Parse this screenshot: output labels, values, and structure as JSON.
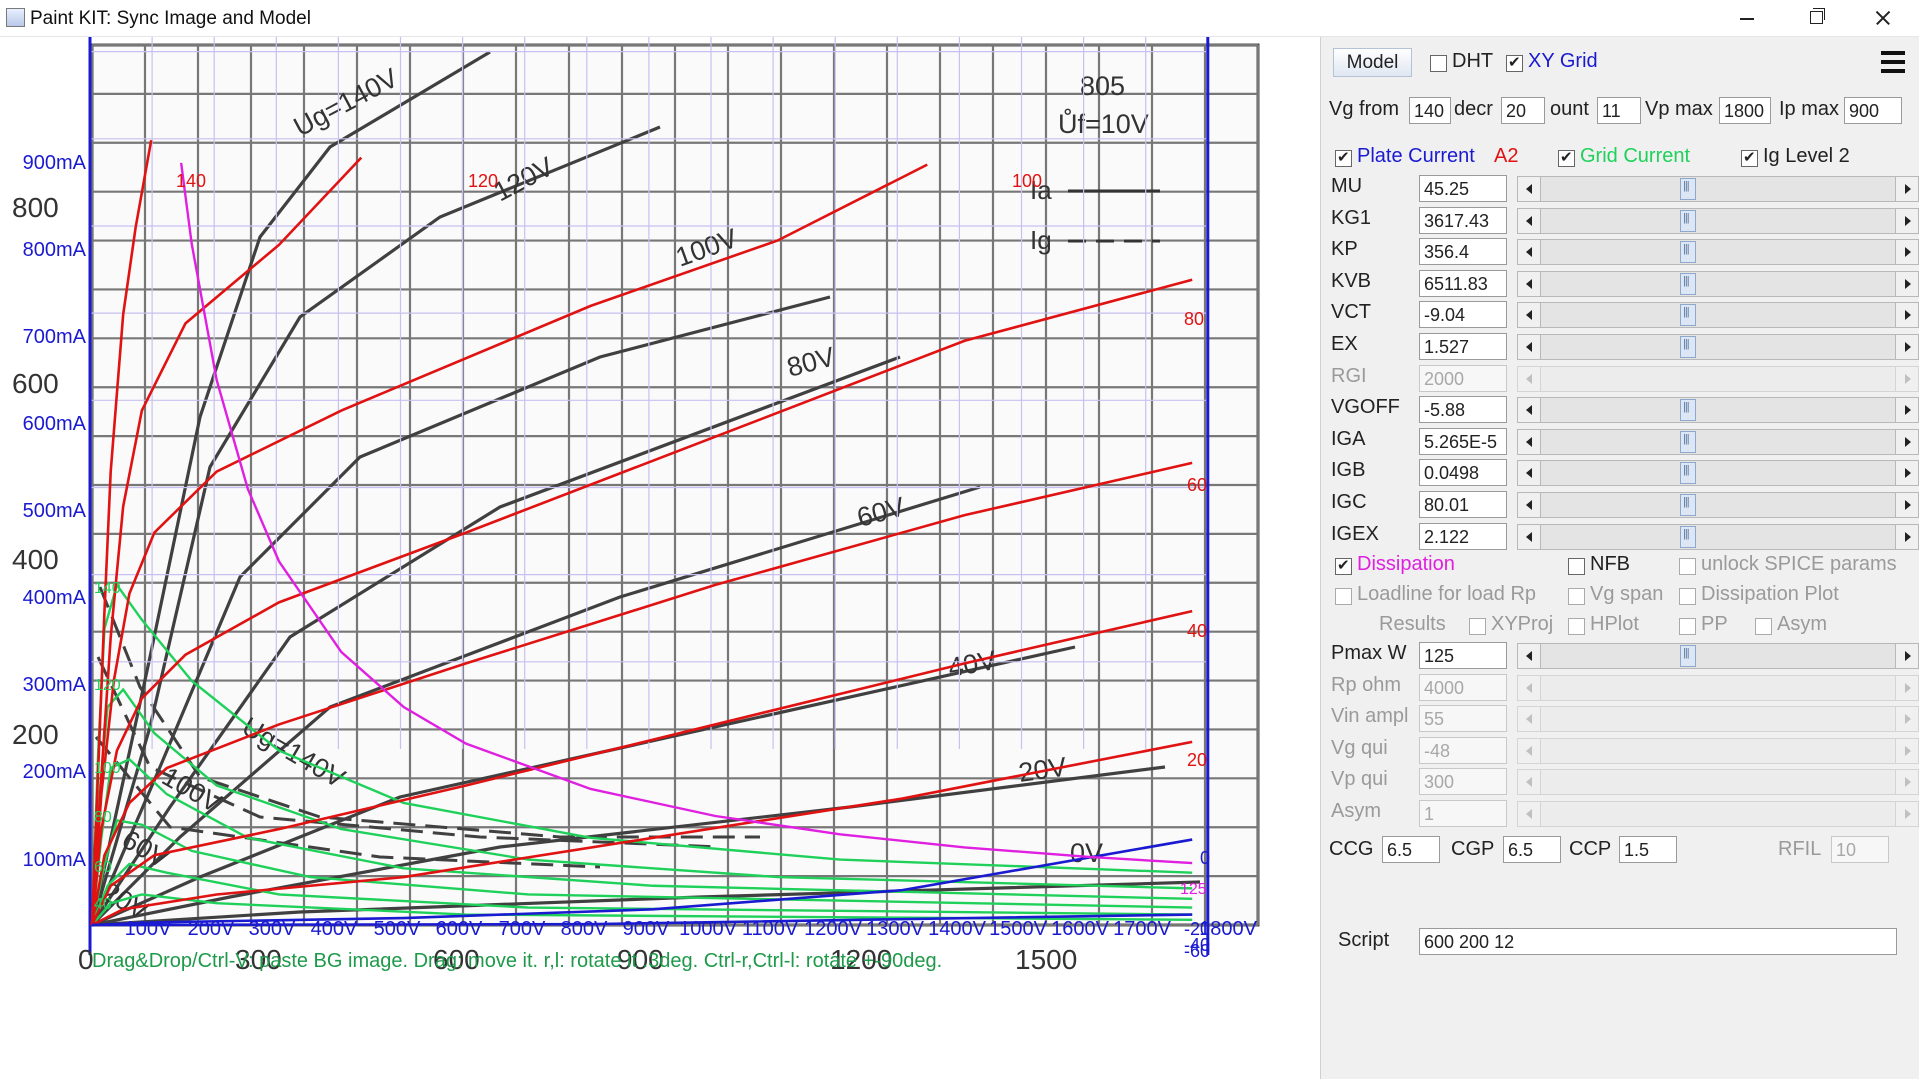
{
  "window": {
    "title": "Paint KIT: Sync Image and Model"
  },
  "chart_data": {
    "type": "line",
    "title": "",
    "xlabel": "",
    "ylabel": "",
    "xlim": [
      0,
      1800
    ],
    "ylim": [
      0,
      1000
    ],
    "x_ticks": [
      "100V",
      "200V",
      "300V",
      "400V",
      "500V",
      "600V",
      "700V",
      "800V",
      "900V",
      "1000V",
      "1100V",
      "1200V",
      "1300V",
      "1400V",
      "1500V",
      "1600V",
      "1700V",
      "1800V"
    ],
    "y_ticks": [
      "100mA",
      "200mA",
      "300mA",
      "400mA",
      "500mA",
      "600mA",
      "700mA",
      "800mA",
      "900mA"
    ],
    "x_origin_label": "0",
    "bg_y_ticks": [
      "200",
      "400",
      "600",
      "800"
    ],
    "bg_x_ticks": [
      "300",
      "600",
      "900",
      "1200",
      "1500"
    ],
    "bg_tube_label": "805",
    "bg_filament_label": "Ůf=10V",
    "bg_legend": [
      "Ia",
      "Ig"
    ],
    "bg_curve_labels": [
      "Ug=140V",
      "120V",
      "100V",
      "80V",
      "60V",
      "40V",
      "20V",
      "0V",
      "Ug=140V",
      "100V",
      "60V",
      "20V"
    ],
    "plate_curves": [
      {
        "name": "140",
        "points": [
          [
            0,
            0
          ],
          [
            10,
            180
          ],
          [
            20,
            360
          ],
          [
            30,
            520
          ],
          [
            50,
            700
          ],
          [
            70,
            800
          ],
          [
            95,
            900
          ]
        ]
      },
      {
        "name": "120",
        "points": [
          [
            0,
            0
          ],
          [
            15,
            170
          ],
          [
            30,
            330
          ],
          [
            50,
            480
          ],
          [
            80,
            590
          ],
          [
            150,
            690
          ],
          [
            300,
            780
          ],
          [
            432,
            880
          ]
        ]
      },
      {
        "name": "100",
        "points": [
          [
            0,
            0
          ],
          [
            15,
            150
          ],
          [
            35,
            280
          ],
          [
            60,
            380
          ],
          [
            100,
            450
          ],
          [
            200,
            520
          ],
          [
            400,
            590
          ],
          [
            800,
            710
          ],
          [
            1100,
            785
          ],
          [
            1340,
            872
          ]
        ]
      },
      {
        "name": "80",
        "points": [
          [
            0,
            0
          ],
          [
            15,
            110
          ],
          [
            40,
            200
          ],
          [
            80,
            260
          ],
          [
            150,
            310
          ],
          [
            300,
            370
          ],
          [
            600,
            450
          ],
          [
            1000,
            560
          ],
          [
            1400,
            670
          ],
          [
            1765,
            740
          ]
        ]
      },
      {
        "name": "60",
        "points": [
          [
            0,
            0
          ],
          [
            20,
            80
          ],
          [
            60,
            140
          ],
          [
            120,
            180
          ],
          [
            300,
            230
          ],
          [
            600,
            300
          ],
          [
            1000,
            390
          ],
          [
            1400,
            470
          ],
          [
            1765,
            530
          ]
        ]
      },
      {
        "name": "40",
        "points": [
          [
            0,
            0
          ],
          [
            30,
            45
          ],
          [
            100,
            80
          ],
          [
            300,
            110
          ],
          [
            600,
            160
          ],
          [
            1000,
            230
          ],
          [
            1400,
            300
          ],
          [
            1765,
            360
          ]
        ]
      },
      {
        "name": "20",
        "points": [
          [
            0,
            0
          ],
          [
            50,
            18
          ],
          [
            200,
            35
          ],
          [
            500,
            55
          ],
          [
            900,
            100
          ],
          [
            1300,
            145
          ],
          [
            1765,
            210
          ]
        ]
      },
      {
        "name": "0",
        "points": [
          [
            0,
            0
          ],
          [
            100,
            3
          ],
          [
            500,
            8
          ],
          [
            900,
            18
          ],
          [
            1300,
            40
          ],
          [
            1765,
            98
          ]
        ]
      },
      {
        "name": "-20",
        "points": [
          [
            0,
            0
          ],
          [
            800,
            1
          ],
          [
            1765,
            12
          ]
        ]
      }
    ],
    "grid_curves": [
      {
        "name": "140",
        "points": [
          [
            0,
            0
          ],
          [
            10,
            200
          ],
          [
            20,
            340
          ],
          [
            40,
            390
          ],
          [
            80,
            350
          ],
          [
            160,
            280
          ],
          [
            300,
            200
          ],
          [
            500,
            140
          ],
          [
            800,
            100
          ],
          [
            1200,
            75
          ],
          [
            1765,
            60
          ]
        ]
      },
      {
        "name": "120",
        "points": [
          [
            0,
            0
          ],
          [
            12,
            150
          ],
          [
            25,
            250
          ],
          [
            50,
            270
          ],
          [
            100,
            220
          ],
          [
            200,
            160
          ],
          [
            400,
            110
          ],
          [
            700,
            75
          ],
          [
            1100,
            55
          ],
          [
            1765,
            42
          ]
        ]
      },
      {
        "name": "100",
        "points": [
          [
            0,
            0
          ],
          [
            15,
            100
          ],
          [
            30,
            180
          ],
          [
            60,
            190
          ],
          [
            120,
            150
          ],
          [
            250,
            100
          ],
          [
            500,
            65
          ],
          [
            900,
            45
          ],
          [
            1765,
            30
          ]
        ]
      },
      {
        "name": "80",
        "points": [
          [
            0,
            0
          ],
          [
            20,
            70
          ],
          [
            40,
            120
          ],
          [
            80,
            115
          ],
          [
            160,
            85
          ],
          [
            350,
            55
          ],
          [
            700,
            35
          ],
          [
            1765,
            20
          ]
        ]
      },
      {
        "name": "60",
        "points": [
          [
            0,
            0
          ],
          [
            25,
            45
          ],
          [
            60,
            70
          ],
          [
            120,
            60
          ],
          [
            300,
            35
          ],
          [
            700,
            20
          ],
          [
            1765,
            12
          ]
        ]
      },
      {
        "name": "40",
        "points": [
          [
            0,
            0
          ],
          [
            30,
            25
          ],
          [
            80,
            35
          ],
          [
            200,
            25
          ],
          [
            600,
            12
          ],
          [
            1765,
            6
          ]
        ]
      }
    ],
    "dissipation_curve": {
      "name": "Pmax 125 W",
      "points": [
        [
          143,
          874
        ],
        [
          160,
          781
        ],
        [
          200,
          625
        ],
        [
          250,
          500
        ],
        [
          300,
          417
        ],
        [
          400,
          313
        ],
        [
          500,
          250
        ],
        [
          600,
          208
        ],
        [
          800,
          156
        ],
        [
          1000,
          125
        ],
        [
          1200,
          104
        ],
        [
          1400,
          89
        ],
        [
          1600,
          78
        ],
        [
          1765,
          71
        ]
      ]
    },
    "curve_labels_right": [
      "100",
      "80",
      "60",
      "40",
      "20",
      "0",
      "-20",
      "-40",
      "-60"
    ],
    "curve_labels_top": [
      "140",
      "120"
    ],
    "grid_labels_left": [
      "140",
      "120",
      "100",
      "80",
      "60",
      "40"
    ],
    "ig_label_right": "125",
    "status_hint": "Drag&Drop/Ctrl-V: paste BG image. Drag: move it. r,l: rotate it .3deg. Ctrl-r,Ctrl-l: rotate +-90deg."
  },
  "panel": {
    "model_button": "Model",
    "dht": {
      "label": "DHT",
      "checked": false
    },
    "xy_grid": {
      "label": "XY Grid",
      "checked": true
    },
    "vg_from": {
      "label": "Vg from",
      "value": "140"
    },
    "decr": {
      "label": "decr",
      "value": "20"
    },
    "count": {
      "label": "ount",
      "value": "11"
    },
    "vp_max": {
      "label": "Vp max",
      "value": "1800"
    },
    "ip_max": {
      "label": "Ip max",
      "value": "900"
    },
    "plate_current": {
      "label": "Plate Current",
      "checked": true
    },
    "a2_label": "A2",
    "grid_current": {
      "label": "Grid Current",
      "checked": true
    },
    "ig_level2": {
      "label": "Ig Level 2",
      "checked": true
    },
    "params": [
      {
        "label": "MU",
        "value": "45.25",
        "enabled": true
      },
      {
        "label": "KG1",
        "value": "3617.43",
        "enabled": true
      },
      {
        "label": "KP",
        "value": "356.4",
        "enabled": true
      },
      {
        "label": "KVB",
        "value": "6511.83",
        "enabled": true
      },
      {
        "label": "VCT",
        "value": "-9.04",
        "enabled": true
      },
      {
        "label": "EX",
        "value": "1.527",
        "enabled": true
      },
      {
        "label": "RGI",
        "value": "2000",
        "enabled": false
      },
      {
        "label": "VGOFF",
        "value": "-5.88",
        "enabled": true
      },
      {
        "label": "IGA",
        "value": "5.265E-5",
        "enabled": true
      },
      {
        "label": "IGB",
        "value": "0.0498",
        "enabled": true
      },
      {
        "label": "IGC",
        "value": "80.01",
        "enabled": true
      },
      {
        "label": "IGEX",
        "value": "2.122",
        "enabled": true
      }
    ],
    "dissipation": {
      "label": "Dissipation",
      "checked": true
    },
    "nfb": {
      "label": "NFB",
      "checked": false
    },
    "unlock_spice": {
      "label": "unlock SPICE params",
      "checked": false
    },
    "loadline": {
      "label": "Loadline for load Rp",
      "checked": false
    },
    "vg_span": {
      "label": "Vg span",
      "checked": false
    },
    "dissipation_plot": {
      "label": "Dissipation Plot",
      "checked": false
    },
    "results_label": "Results",
    "xyproj": {
      "label": "XYProj",
      "checked": false
    },
    "hplot": {
      "label": "HPlot",
      "checked": false
    },
    "pp": {
      "label": "PP",
      "checked": false
    },
    "asym": {
      "label": "Asym",
      "checked": false
    },
    "load_params": [
      {
        "label": "Pmax W",
        "value": "125",
        "enabled": true
      },
      {
        "label": "Rp ohm",
        "value": "4000",
        "enabled": false
      },
      {
        "label": "Vin ampl",
        "value": "55",
        "enabled": false
      },
      {
        "label": "Vg qui",
        "value": "-48",
        "enabled": false
      },
      {
        "label": "Vp qui",
        "value": "300",
        "enabled": false
      },
      {
        "label": "Asym",
        "value": "1",
        "enabled": false
      }
    ],
    "ccg": {
      "label": "CCG",
      "value": "6.5"
    },
    "cgp": {
      "label": "CGP",
      "value": "6.5"
    },
    "ccp": {
      "label": "CCP",
      "value": "1.5"
    },
    "rfil": {
      "label": "RFIL",
      "value": "10"
    },
    "script": {
      "label": "Script",
      "value": "600 200 12"
    }
  }
}
